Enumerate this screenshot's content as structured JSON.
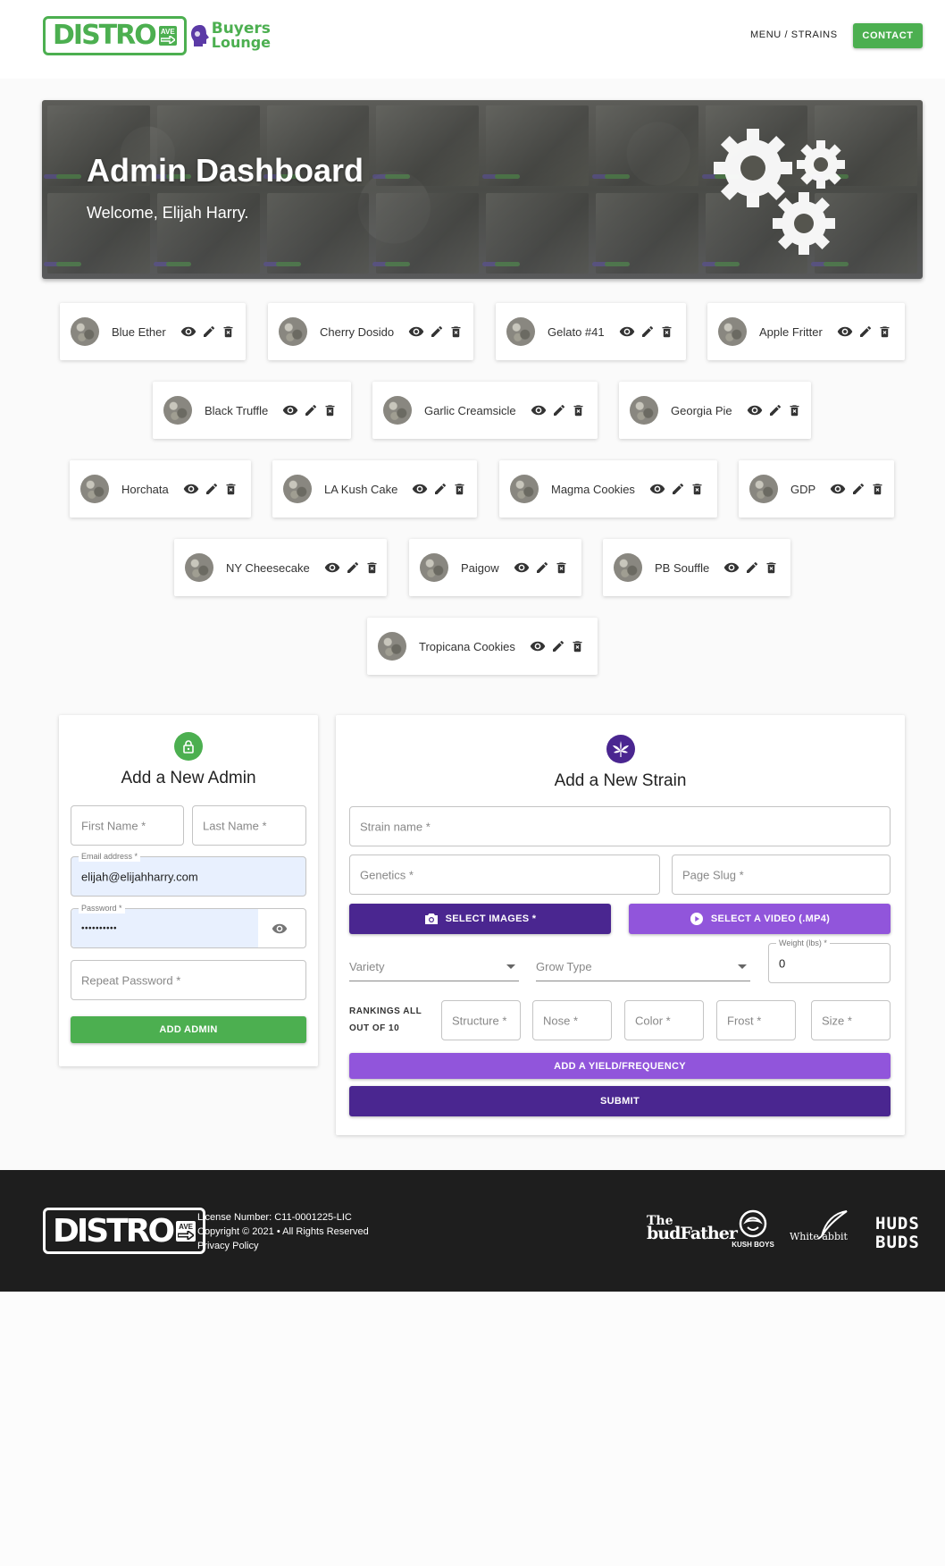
{
  "header": {
    "logo_main": "DISTRO",
    "logo_ave_1": "AVE",
    "logo_buyers_1": "Buyers",
    "logo_buyers_2": "Lounge",
    "nav_menu": "MENU / STRAINS",
    "nav_contact": "CONTACT"
  },
  "hero": {
    "title": "Admin Dashboard",
    "welcome": "Welcome, Elijah Harry."
  },
  "strains": [
    {
      "label": "Blue Ether"
    },
    {
      "label": "Cherry Dosido"
    },
    {
      "label": "Gelato #41"
    },
    {
      "label": "Apple Fritter"
    },
    {
      "label": "Black Truffle"
    },
    {
      "label": "Garlic Creamsicle"
    },
    {
      "label": "Georgia Pie"
    },
    {
      "label": "Horchata"
    },
    {
      "label": "LA Kush Cake"
    },
    {
      "label": "Magma Cookies"
    },
    {
      "label": "GDP"
    },
    {
      "label": "NY Cheesecake"
    },
    {
      "label": "Paigow"
    },
    {
      "label": "PB Souffle"
    },
    {
      "label": "Tropicana Cookies"
    }
  ],
  "admin_form": {
    "title": "Add a New Admin",
    "first_name_placeholder": "First Name *",
    "last_name_placeholder": "Last Name *",
    "email_label": "Email address *",
    "email_value": "elijah@elijahharry.com",
    "password_label": "Password *",
    "password_value": "••••••••••",
    "repeat_password_placeholder": "Repeat Password *",
    "submit_label": "ADD ADMIN"
  },
  "strain_form": {
    "title": "Add a New Strain",
    "strain_name_placeholder": "Strain name *",
    "genetics_placeholder": "Genetics *",
    "page_slug_placeholder": "Page Slug *",
    "select_images_label": "SELECT IMAGES *",
    "select_video_label": "SELECT A VIDEO (.MP4)",
    "variety_placeholder": "Variety",
    "grow_type_placeholder": "Grow Type",
    "weight_label": "Weight (lbs) *",
    "weight_value": "0",
    "rankings_label_1": "RANKINGS ALL",
    "rankings_label_2": "OUT OF 10",
    "structure_placeholder": "Structure *",
    "nose_placeholder": "Nose *",
    "color_placeholder": "Color *",
    "frost_placeholder": "Frost *",
    "size_placeholder": "Size *",
    "add_yield_label": "ADD A YIELD/FREQUENCY",
    "submit_label": "SUBMIT"
  },
  "footer": {
    "logo_main": "DISTRO",
    "logo_ave": "AVE",
    "license": "License Number: C11-0001225-LIC",
    "copyright": "Copyright © 2021 • All Rights Reserved",
    "privacy": "Privacy Policy",
    "brand_1_top": "The",
    "brand_1_bottom": "budFather",
    "brand_2": "KUSH BOYS",
    "brand_3_a": "White",
    "brand_3_b": "abbit",
    "brand_4_top": "HUDS",
    "brand_4_bottom": "BUDS"
  },
  "colors": {
    "green": "#4caf50",
    "purple_dark": "#4a2690",
    "purple_light": "#9155db",
    "footer_bg": "#1e1e1e"
  }
}
